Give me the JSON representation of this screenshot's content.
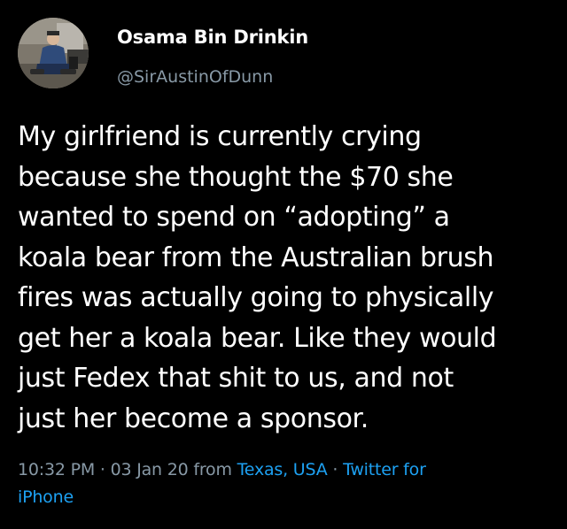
{
  "user": {
    "display_name": "Osama Bin Drinkin",
    "handle": "@SirAustinOfDunn"
  },
  "tweet": {
    "lines": [
      "My girlfriend is currently crying",
      "because she thought the $70 she",
      "wanted to spend on “adopting” a",
      "koala bear from the Australian brush",
      "fires was actually going to physically",
      "get her a koala bear. Like they would",
      "just Fedex that shit to us, and not",
      "just her become a sponsor."
    ]
  },
  "meta": {
    "time": "10:32 PM",
    "sep1": " · ",
    "date": "03 Jan 20",
    "from_text": " from ",
    "location": "Texas, USA",
    "sep2": " · ",
    "source_part1": "Twitter for",
    "source_part2": "iPhone"
  },
  "colors": {
    "background": "#000000",
    "text": "#ffffff",
    "secondary": "#8899a6",
    "link": "#1da1f2"
  },
  "icons": {
    "avatar": "profile-photo"
  }
}
